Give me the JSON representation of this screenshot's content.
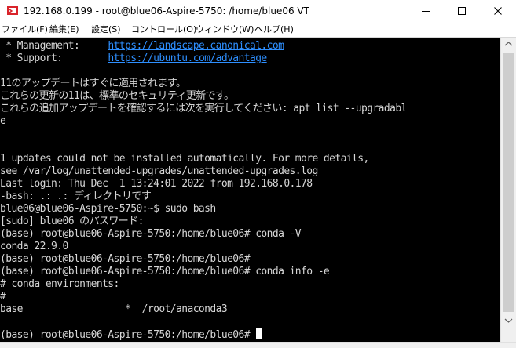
{
  "window": {
    "title": "192.168.0.199 - root@blue06-Aspire-5750: /home/blue06 VT",
    "app_icon": "teraterm-icon",
    "controls": [
      "minimize-icon",
      "maximize-icon",
      "close-icon"
    ]
  },
  "menubar": {
    "items": [
      {
        "label": "ファイル(F)"
      },
      {
        "label": "編集(E)"
      },
      {
        "label": "設定(S)"
      },
      {
        "label": "コントロール(O)"
      },
      {
        "label": "ウィンドウ(W)"
      },
      {
        "label": "ヘルプ(H)"
      }
    ]
  },
  "terminal": {
    "colors": {
      "background": "#000000",
      "text": "#d6d6d6",
      "link": "#2e8fff",
      "cursor": "#ffffff"
    },
    "lines": [
      {
        "prefix": " * Management:     ",
        "link": "https://landscape.canonical.com"
      },
      {
        "prefix": " * Support:        ",
        "link": "https://ubuntu.com/advantage"
      },
      {
        "text": ""
      },
      {
        "text": "11のアップデートはすぐに適用されます。"
      },
      {
        "text": "これらの更新の11は、標準のセキュリティ更新です。"
      },
      {
        "text": "これらの追加アップデートを確認するには次を実行してください: apt list --upgradabl"
      },
      {
        "text": "e"
      },
      {
        "text": ""
      },
      {
        "text": ""
      },
      {
        "text": "1 updates could not be installed automatically. For more details,"
      },
      {
        "text": "see /var/log/unattended-upgrades/unattended-upgrades.log"
      },
      {
        "text": "Last login: Thu Dec  1 13:24:01 2022 from 192.168.0.178"
      },
      {
        "text": "-bash: .: .: ディレクトリです"
      },
      {
        "text": "blue06@blue06-Aspire-5750:~$ sudo bash"
      },
      {
        "text": "[sudo] blue06 のパスワード:"
      },
      {
        "text": "(base) root@blue06-Aspire-5750:/home/blue06# conda -V"
      },
      {
        "text": "conda 22.9.0"
      },
      {
        "text": "(base) root@blue06-Aspire-5750:/home/blue06#"
      },
      {
        "text": "(base) root@blue06-Aspire-5750:/home/blue06# conda info -e"
      },
      {
        "text": "# conda environments:"
      },
      {
        "text": "#"
      },
      {
        "text": "base                  *  /root/anaconda3"
      },
      {
        "text": ""
      },
      {
        "text": "(base) root@blue06-Aspire-5750:/home/blue06# "
      }
    ]
  }
}
